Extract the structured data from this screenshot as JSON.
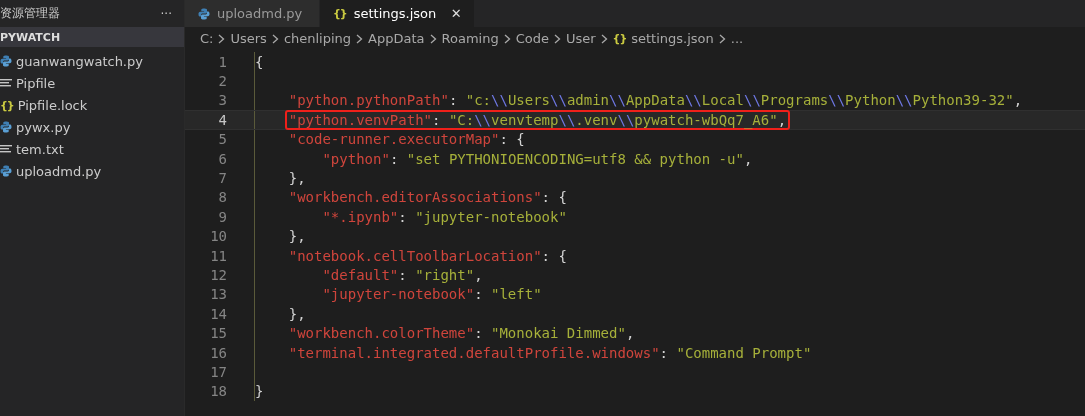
{
  "sidebar": {
    "title": "资源管理器",
    "more": "···",
    "section": "PYWATCH",
    "files": [
      {
        "name": "guanwangwatch.py",
        "kind": "python"
      },
      {
        "name": "Pipfile",
        "kind": "text"
      },
      {
        "name": "Pipfile.lock",
        "kind": "json",
        "glyph": "{}"
      },
      {
        "name": "pywx.py",
        "kind": "python"
      },
      {
        "name": "tem.txt",
        "kind": "text"
      },
      {
        "name": "uploadmd.py",
        "kind": "python"
      }
    ]
  },
  "tabs": [
    {
      "label": "uploadmd.py",
      "kind": "python",
      "selected": false
    },
    {
      "label": "settings.json",
      "kind": "json",
      "glyph": "{}",
      "selected": true,
      "close": "✕"
    }
  ],
  "breadcrumb": {
    "glyph": "{}",
    "items": [
      "C:",
      "Users",
      "chenliping",
      "AppData",
      "Roaming",
      "Code",
      "User",
      "settings.json",
      "..."
    ]
  },
  "editor": {
    "lines": [
      {
        "number": "1",
        "current": false,
        "annotated": false,
        "tokens": [
          {
            "kind": "punct",
            "text": "{"
          }
        ]
      },
      {
        "number": "2",
        "current": false,
        "annotated": false
      },
      {
        "number": "3",
        "current": false,
        "annotated": false,
        "tokens": [
          {
            "kind": "key",
            "text": "    \"python.pythonPath\""
          },
          {
            "kind": "punct",
            "text": ": "
          },
          {
            "kind": "string",
            "text": "\"c:"
          },
          {
            "kind": "escape",
            "text": "\\\\"
          },
          {
            "kind": "string",
            "text": "Users"
          },
          {
            "kind": "escape",
            "text": "\\\\"
          },
          {
            "kind": "string",
            "text": "admin"
          },
          {
            "kind": "escape",
            "text": "\\\\"
          },
          {
            "kind": "string",
            "text": "AppData"
          },
          {
            "kind": "escape",
            "text": "\\\\"
          },
          {
            "kind": "string",
            "text": "Local"
          },
          {
            "kind": "escape",
            "text": "\\\\"
          },
          {
            "kind": "string",
            "text": "Programs"
          },
          {
            "kind": "escape",
            "text": "\\\\"
          },
          {
            "kind": "string",
            "text": "Python"
          },
          {
            "kind": "escape",
            "text": "\\\\"
          },
          {
            "kind": "string",
            "text": "Python39-32\""
          },
          {
            "kind": "punct",
            "text": ","
          }
        ]
      },
      {
        "number": "4",
        "current": true,
        "annotated": true,
        "tokens": [
          {
            "kind": "key",
            "text": "    \"python.venvPath\""
          },
          {
            "kind": "punct",
            "text": ": "
          },
          {
            "kind": "string",
            "text": "\"C:"
          },
          {
            "kind": "escape",
            "text": "\\\\"
          },
          {
            "kind": "string",
            "text": "venvtemp"
          },
          {
            "kind": "escape",
            "text": "\\\\"
          },
          {
            "kind": "string",
            "text": ".venv"
          },
          {
            "kind": "escape",
            "text": "\\\\"
          },
          {
            "kind": "string",
            "text": "pywatch-wbQq7_A6\""
          },
          {
            "kind": "punct",
            "text": ","
          }
        ]
      },
      {
        "number": "5",
        "current": false,
        "annotated": false,
        "tokens": [
          {
            "kind": "key",
            "text": "    \"code-runner.executorMap\""
          },
          {
            "kind": "punct",
            "text": ": {"
          }
        ]
      },
      {
        "number": "6",
        "current": false,
        "annotated": false,
        "tokens": [
          {
            "kind": "key",
            "text": "        \"python\""
          },
          {
            "kind": "punct",
            "text": ": "
          },
          {
            "kind": "string",
            "text": "\"set PYTHONIOENCODING=utf8 && python -u\""
          },
          {
            "kind": "punct",
            "text": ","
          }
        ]
      },
      {
        "number": "7",
        "current": false,
        "annotated": false,
        "tokens": [
          {
            "kind": "punct",
            "text": "    },"
          }
        ]
      },
      {
        "number": "8",
        "current": false,
        "annotated": false,
        "tokens": [
          {
            "kind": "key",
            "text": "    \"workbench.editorAssociations\""
          },
          {
            "kind": "punct",
            "text": ": {"
          }
        ]
      },
      {
        "number": "9",
        "current": false,
        "annotated": false,
        "tokens": [
          {
            "kind": "key",
            "text": "        \"*.ipynb\""
          },
          {
            "kind": "punct",
            "text": ": "
          },
          {
            "kind": "string",
            "text": "\"jupyter-notebook\""
          }
        ]
      },
      {
        "number": "10",
        "current": false,
        "annotated": false,
        "tokens": [
          {
            "kind": "punct",
            "text": "    },"
          }
        ]
      },
      {
        "number": "11",
        "current": false,
        "annotated": false,
        "tokens": [
          {
            "kind": "key",
            "text": "    \"notebook.cellToolbarLocation\""
          },
          {
            "kind": "punct",
            "text": ": {"
          }
        ]
      },
      {
        "number": "12",
        "current": false,
        "annotated": false,
        "tokens": [
          {
            "kind": "key",
            "text": "        \"default\""
          },
          {
            "kind": "punct",
            "text": ": "
          },
          {
            "kind": "string",
            "text": "\"right\""
          },
          {
            "kind": "punct",
            "text": ","
          }
        ]
      },
      {
        "number": "13",
        "current": false,
        "annotated": false,
        "tokens": [
          {
            "kind": "key",
            "text": "        \"jupyter-notebook\""
          },
          {
            "kind": "punct",
            "text": ": "
          },
          {
            "kind": "string",
            "text": "\"left\""
          }
        ]
      },
      {
        "number": "14",
        "current": false,
        "annotated": false,
        "tokens": [
          {
            "kind": "punct",
            "text": "    },"
          }
        ]
      },
      {
        "number": "15",
        "current": false,
        "annotated": false,
        "tokens": [
          {
            "kind": "key",
            "text": "    \"workbench.colorTheme\""
          },
          {
            "kind": "punct",
            "text": ": "
          },
          {
            "kind": "string",
            "text": "\"Monokai Dimmed\""
          },
          {
            "kind": "punct",
            "text": ","
          }
        ]
      },
      {
        "number": "16",
        "current": false,
        "annotated": false,
        "tokens": [
          {
            "kind": "key",
            "text": "    \"terminal.integrated.defaultProfile.windows\""
          },
          {
            "kind": "punct",
            "text": ": "
          },
          {
            "kind": "string",
            "text": "\"Command Prompt\""
          }
        ]
      },
      {
        "number": "17",
        "current": false,
        "annotated": false
      },
      {
        "number": "18",
        "current": false,
        "annotated": false,
        "tokens": [
          {
            "kind": "punct",
            "text": "}"
          }
        ]
      }
    ]
  }
}
